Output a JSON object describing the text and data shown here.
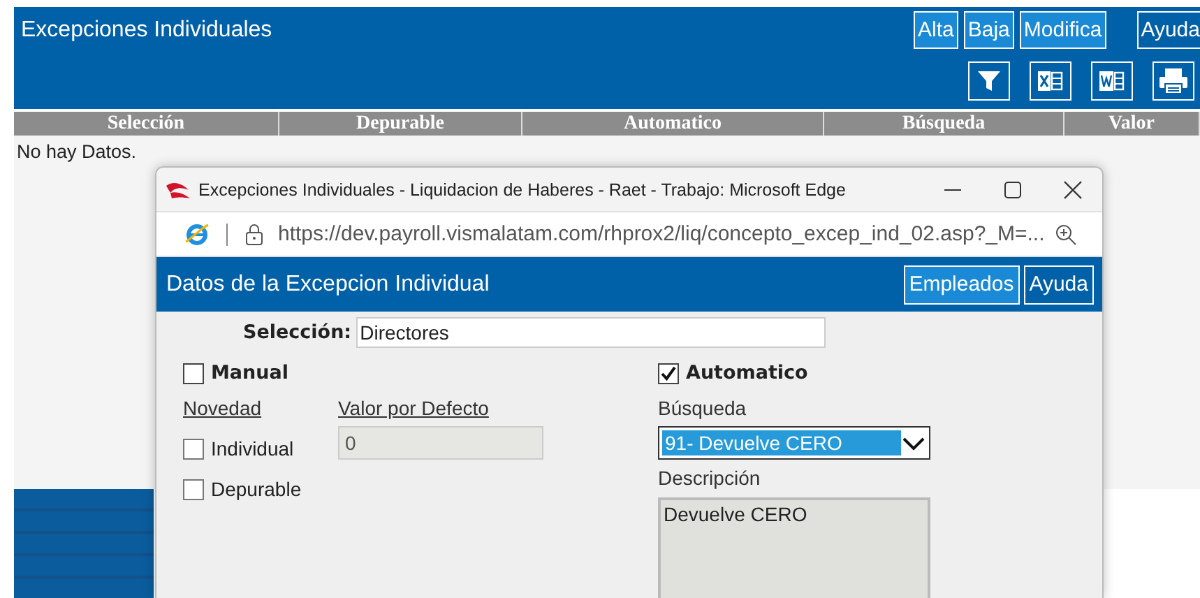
{
  "page": {
    "title": "Excepciones Individuales",
    "buttons": [
      "Alta",
      "Baja",
      "Modifica",
      "Ayuda"
    ],
    "tools": [
      {
        "kind": "filter"
      },
      {
        "kind": "excel"
      },
      {
        "kind": "word"
      },
      {
        "kind": "print"
      }
    ],
    "columns": [
      "Selección",
      "Depurable",
      "Automatico",
      "Búsqueda",
      "Valor"
    ],
    "empty_message": "No hay Datos."
  },
  "popup": {
    "window_title": "Excepciones Individuales - Liquidacion de Haberes - Raet - Trabajo: Microsoft Edge",
    "url": "https://dev.payroll.vismalatam.com/rhprox2/liq/concepto_excep_ind_02.asp?_M=...",
    "header": "Datos de la Excepcion Individual",
    "buttons": [
      "Empleados",
      "Ayuda"
    ],
    "form": {
      "seleccion": {
        "label": "Selección:",
        "value": "Directores"
      },
      "manual": {
        "label": "Manual",
        "checked": false
      },
      "automatico": {
        "label": "Automatico",
        "checked": true
      },
      "novedad_heading": "Novedad",
      "valor_heading": "Valor por Defecto",
      "individual": {
        "label": "Individual",
        "checked": false
      },
      "valor_por_defecto": {
        "value": "0",
        "disabled": true
      },
      "depurable": {
        "label": "Depurable",
        "checked": false
      },
      "busqueda": {
        "label": "Búsqueda",
        "value": "91- Devuelve CERO"
      },
      "descripcion": {
        "label": "Descripción",
        "value": "Devuelve CERO"
      }
    }
  }
}
